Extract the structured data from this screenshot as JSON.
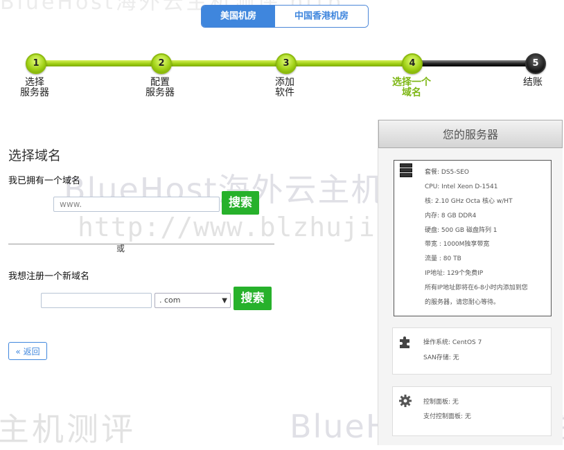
{
  "tabs": [
    {
      "label": "美国机房",
      "active": true
    },
    {
      "label": "中国香港机房",
      "active": false
    }
  ],
  "steps": [
    {
      "num": "1",
      "line1": "选择",
      "line2": "服务器"
    },
    {
      "num": "2",
      "line1": "配置",
      "line2": "服务器"
    },
    {
      "num": "3",
      "line1": "添加",
      "line2": "软件"
    },
    {
      "num": "4",
      "line1": "选择一个",
      "line2": "域名"
    },
    {
      "num": "5",
      "line1": "结账",
      "line2": ""
    }
  ],
  "current_step": 4,
  "main": {
    "title": "选择域名",
    "own_label": "我已拥有一个域名",
    "own_placeholder": "www.",
    "search_label": "搜索",
    "or_label": "或",
    "new_label": "我想注册一个新域名",
    "tld_selected": ". com",
    "back_label": "« 返回"
  },
  "sidebar": {
    "title": "您的服务器",
    "specs": [
      "套餐: DS5-SEO",
      "CPU: Intel Xeon D-1541",
      "核: 2.10 GHz Octa 核心 w/HT",
      "内存: 8 GB DDR4",
      "硬盘: 500 GB 磁盘阵列 1",
      "带宽 : 1000M独享带宽",
      "流量 : 80 TB",
      "IP地址: 129个免费IP",
      "所有IP地址即将在6-8小时内添加到您",
      "的服务器，请您耐心等待。"
    ],
    "os": [
      "操作系统: CentOS 7",
      "SAN存储: 无"
    ],
    "cp": [
      "控制面板: 无",
      "支付控制面板: 无"
    ]
  },
  "watermark": {
    "top": "BlueHost海外云主机测评 http",
    "mid1": "BlueHost海外云主机测评",
    "mid2": "http://www.blzhuji.com",
    "bot1": "主机测评",
    "bot2": "BlueHost海外云主"
  },
  "colors": {
    "accent_blue": "#3f86dd",
    "step_green": "#9ccc10",
    "search_green": "#27b12b"
  }
}
